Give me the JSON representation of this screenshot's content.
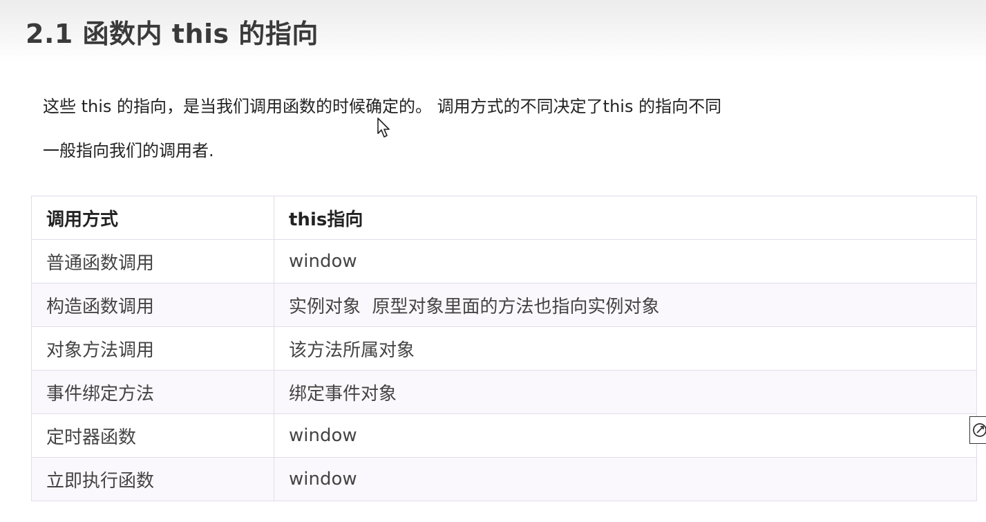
{
  "page": {
    "title": "2.1 函数内 this 的指向"
  },
  "intro": {
    "line1": "这些 this 的指向，是当我们调用函数的时候确定的。 调用方式的不同决定了this 的指向不同",
    "line2": "一般指向我们的调用者."
  },
  "table": {
    "headers": [
      "调用方式",
      "this指向"
    ],
    "rows": [
      [
        "普通函数调用",
        "window"
      ],
      [
        "构造函数调用",
        "实例对象  原型对象里面的方法也指向实例对象"
      ],
      [
        "对象方法调用",
        "该方法所属对象"
      ],
      [
        "事件绑定方法",
        "绑定事件对象"
      ],
      [
        "定时器函数",
        "window"
      ],
      [
        "立即执行函数",
        "window"
      ]
    ]
  },
  "colors": {
    "table_border": "#e2dbe8",
    "row_alt_bg": "#fbf8fd",
    "title_text": "#3a3a3a"
  },
  "icons": {
    "cursor": "mouse-pointer-icon",
    "side_widget": "reload-icon"
  }
}
